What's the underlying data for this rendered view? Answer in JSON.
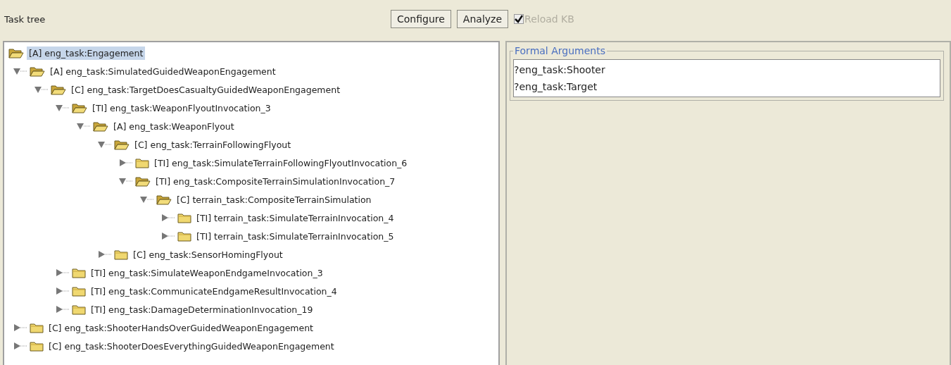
{
  "header": {
    "title": "Task tree"
  },
  "toolbar": {
    "buttons": [
      "Configure",
      "Analyze"
    ],
    "reload_kb": {
      "label": "Reload KB",
      "checked": true,
      "disabled": true
    }
  },
  "tree": [
    {
      "label": "[A] eng_task:Engagement",
      "selected": true,
      "expanded": true,
      "children": [
        {
          "label": "[A] eng_task:SimulatedGuidedWeaponEngagement",
          "selected": false,
          "expanded": true,
          "children": [
            {
              "label": "[C] eng_task:TargetDoesCasualtyGuidedWeaponEngagement",
              "selected": false,
              "expanded": true,
              "children": [
                {
                  "label": "[TI] eng_task:WeaponFlyoutInvocation_3",
                  "selected": false,
                  "expanded": true,
                  "children": [
                    {
                      "label": "[A] eng_task:WeaponFlyout",
                      "selected": false,
                      "expanded": true,
                      "children": [
                        {
                          "label": "[C] eng_task:TerrainFollowingFlyout",
                          "selected": false,
                          "expanded": true,
                          "children": [
                            {
                              "label": "[TI] eng_task:SimulateTerrainFollowingFlyoutInvocation_6",
                              "selected": false,
                              "expanded": false
                            },
                            {
                              "label": "[TI] eng_task:CompositeTerrainSimulationInvocation_7",
                              "selected": false,
                              "expanded": true,
                              "children": [
                                {
                                  "label": "[C] terrain_task:CompositeTerrainSimulation",
                                  "selected": false,
                                  "expanded": true,
                                  "children": [
                                    {
                                      "label": "[TI] terrain_task:SimulateTerrainInvocation_4",
                                      "selected": false,
                                      "expanded": false
                                    },
                                    {
                                      "label": "[TI] terrain_task:SimulateTerrainInvocation_5",
                                      "selected": false,
                                      "expanded": false
                                    }
                                  ]
                                }
                              ]
                            }
                          ]
                        },
                        {
                          "label": "[C] eng_task:SensorHomingFlyout",
                          "selected": false,
                          "expanded": false
                        }
                      ]
                    }
                  ]
                },
                {
                  "label": "[TI] eng_task:SimulateWeaponEndgameInvocation_3",
                  "selected": false,
                  "expanded": false
                },
                {
                  "label": "[TI] eng_task:CommunicateEndgameResultInvocation_4",
                  "selected": false,
                  "expanded": false
                },
                {
                  "label": "[TI] eng_task:DamageDeterminationInvocation_19",
                  "selected": false,
                  "expanded": false
                }
              ]
            }
          ]
        },
        {
          "label": "[C] eng_task:ShooterHandsOverGuidedWeaponEngagement",
          "selected": false,
          "expanded": false
        },
        {
          "label": "[C] eng_task:ShooterDoesEverythingGuidedWeaponEngagement",
          "selected": false,
          "expanded": false
        }
      ]
    }
  ],
  "formal_arguments": {
    "title": "Formal Arguments",
    "items": [
      "?eng_task:Shooter",
      "?eng_task:Target"
    ]
  }
}
